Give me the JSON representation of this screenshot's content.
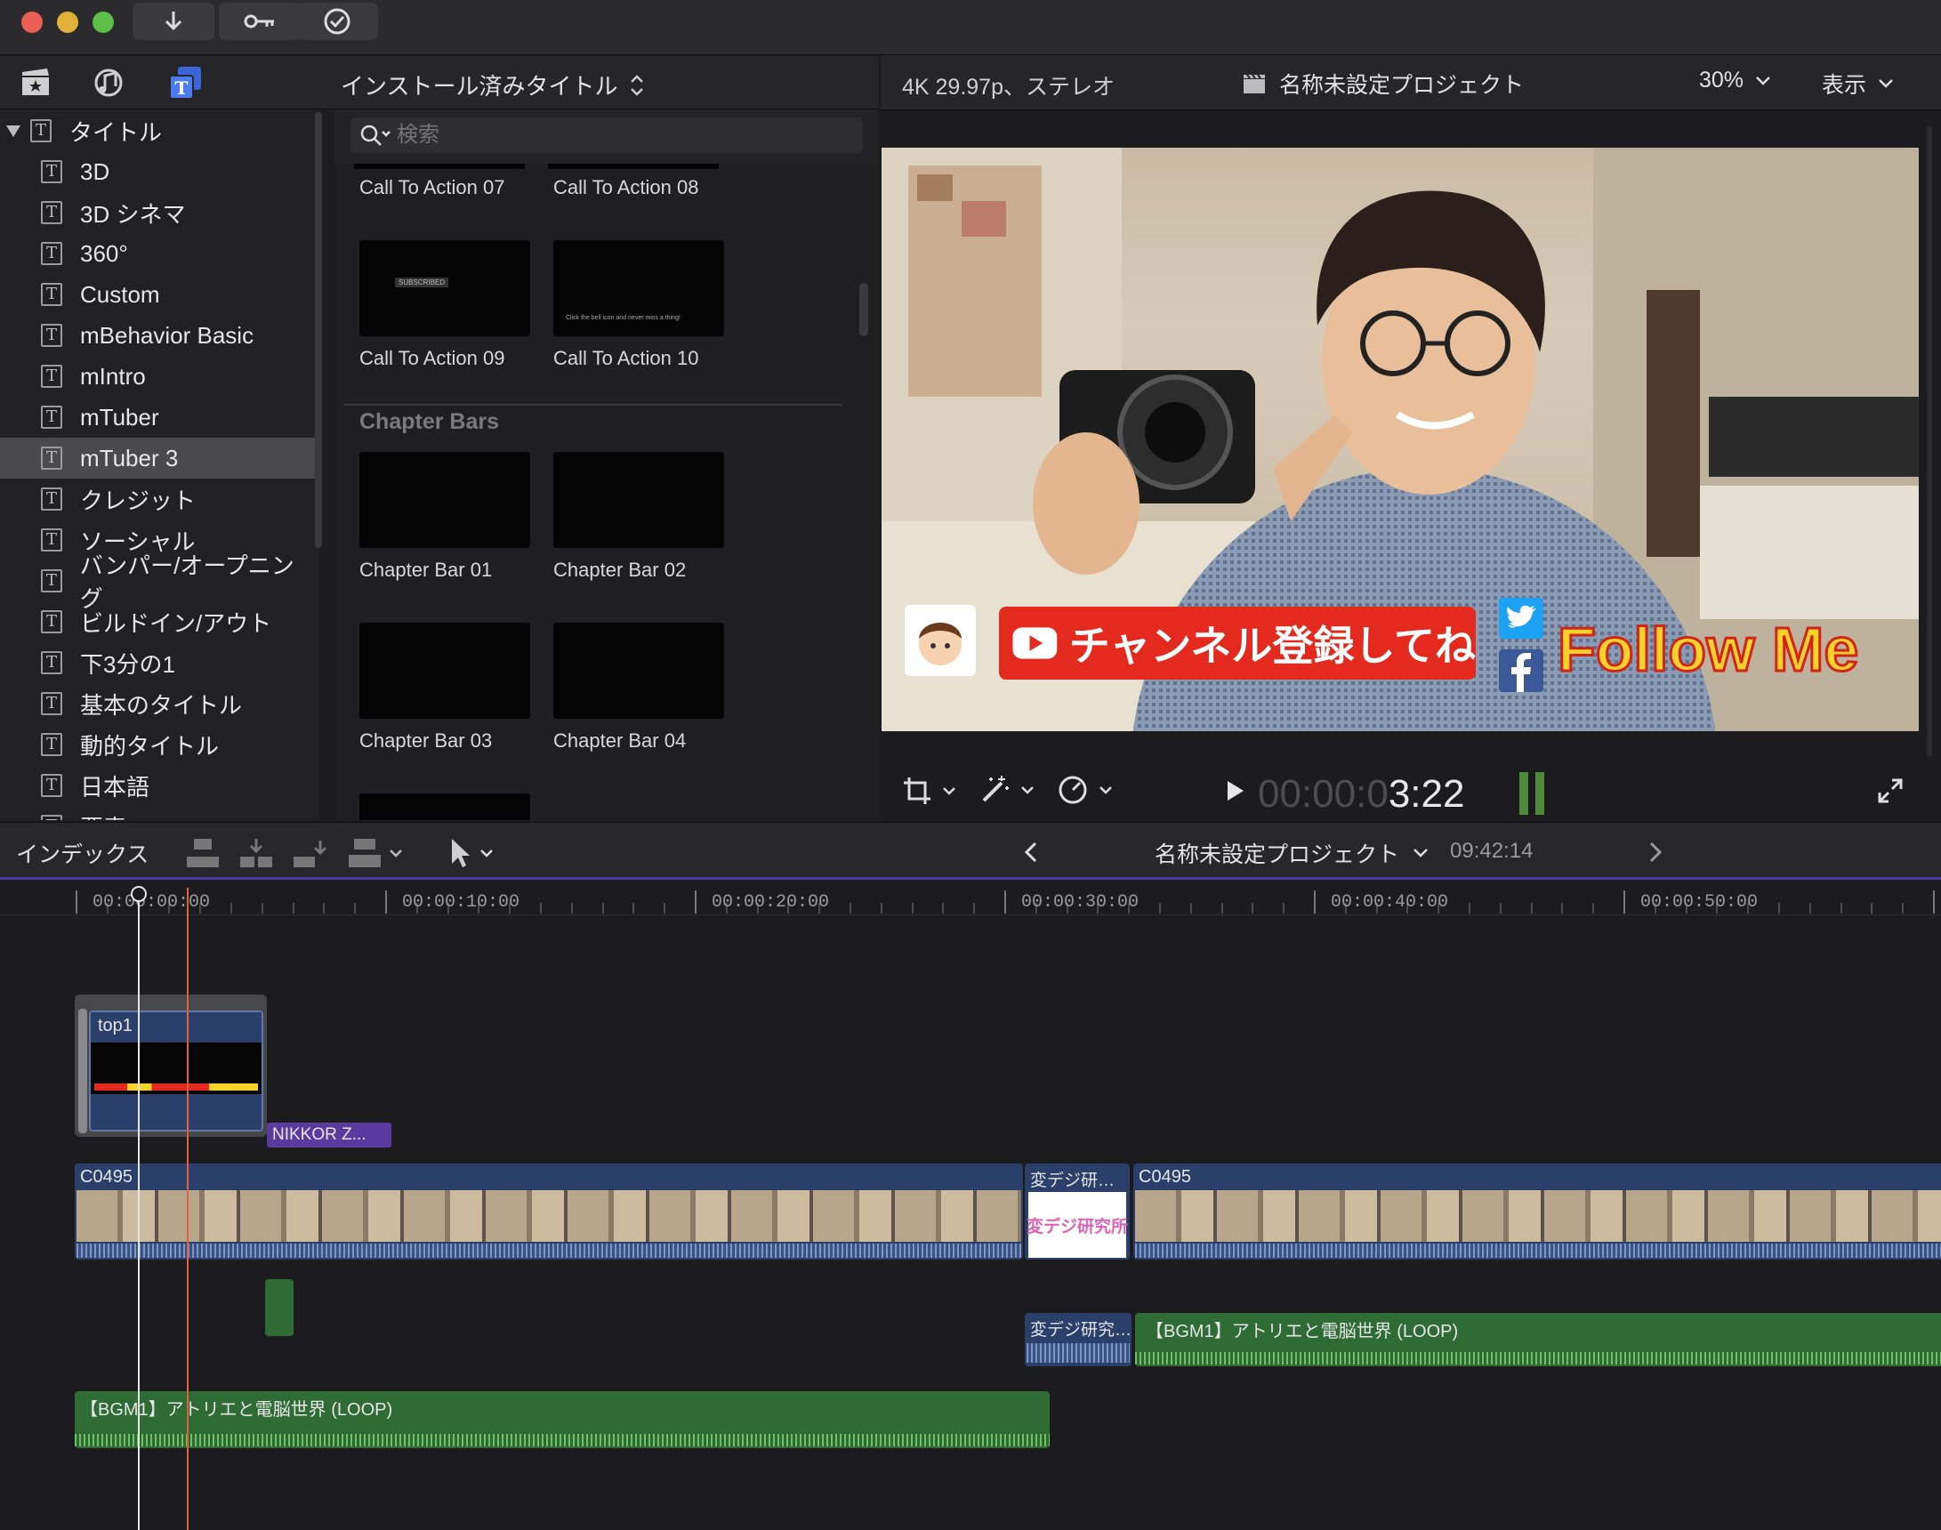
{
  "browser": {
    "library_title": "インストール済みタイトル",
    "search_placeholder": "検索",
    "sidebar_items": [
      "タイトル",
      "3D",
      "3D シネマ",
      "360°",
      "Custom",
      "mBehavior Basic",
      "mIntro",
      "mTuber",
      "mTuber 3",
      "クレジット",
      "ソーシャル",
      "バンパー/オープニング",
      "ビルドイン/アウト",
      "下3分の1",
      "基本のタイトル",
      "動的タイトル",
      "日本語",
      "要素"
    ],
    "grid": {
      "call_to_action": [
        "Call To Action 07",
        "Call To Action 08",
        "Call To Action 09",
        "Call To Action 10"
      ],
      "section_header": "Chapter Bars",
      "chapter_bars": [
        "Chapter Bar 01",
        "Chapter Bar 02",
        "Chapter Bar 03",
        "Chapter Bar 04"
      ],
      "thumb_09_text": "SUBSCRIBED",
      "thumb_10_text": "Click the bell icon and never miss a thing!"
    }
  },
  "viewer": {
    "format": "4K 29.97p、ステレオ",
    "project": "名称未設定プロジェクト",
    "zoom": "30%",
    "view_menu": "表示",
    "timecode_dim": "00:00:0",
    "timecode_bright": "3:22",
    "overlay": {
      "subscribe": "チャンネル登録してね",
      "follow": "Follow Me"
    }
  },
  "timeline_toolbar": {
    "index": "インデックス",
    "project": "名称未設定プロジェクト",
    "duration": "09:42:14"
  },
  "ruler": [
    "00:00:00:00",
    "00:00:10:00",
    "00:00:20:00",
    "00:00:30:00",
    "00:00:40:00",
    "00:00:50:00"
  ],
  "clips": {
    "title_clip": "top1",
    "nikkor": "NIKKOR Z...",
    "main1": "C0495",
    "hendeji_title": "変デジ研…",
    "hendeji_thumb": "変デジ研究所",
    "main2": "C0495",
    "hendeji_audio": "変デジ研究…",
    "bgm_right": "【BGM1】アトリエと電脳世界 (LOOP)",
    "bgm_left": "【BGM1】アトリエと電脳世界 (LOOP)"
  },
  "colors": {
    "accent_blue": "#4a7cf0",
    "clip_blue": "#2b3f6b",
    "audio_green": "#2f6b34",
    "connected_purple": "#5b3aa0",
    "playhead": "#e06040"
  }
}
